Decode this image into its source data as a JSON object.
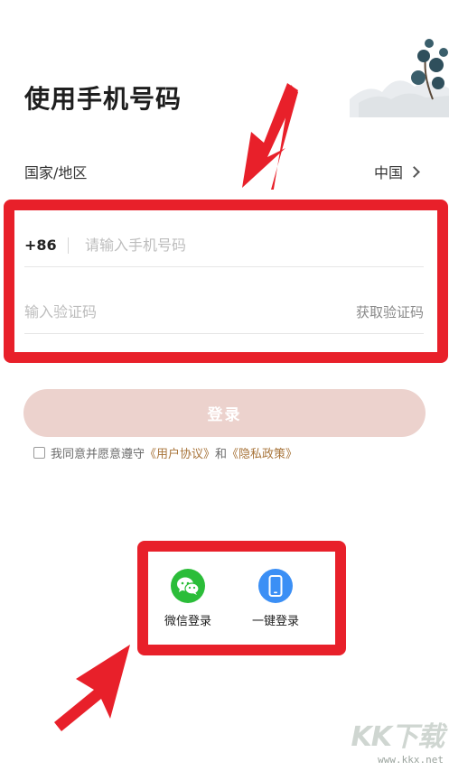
{
  "header": {
    "title": "使用手机号码"
  },
  "region": {
    "label": "国家/地区",
    "value": "中国"
  },
  "form": {
    "country_code": "+86",
    "phone_placeholder": "请输入手机号码",
    "code_placeholder": "输入验证码",
    "get_code_label": "获取验证码",
    "login_label": "登录"
  },
  "agreement": {
    "prefix": "我同意并愿意遵守",
    "user_agreement": "《用户协议》",
    "and": "和",
    "privacy_policy": "《隐私政策》",
    "checked": false
  },
  "social": [
    {
      "label": "微信登录",
      "icon": "wechat-icon"
    },
    {
      "label": "一键登录",
      "icon": "phone-icon"
    }
  ],
  "watermark": {
    "logo": "KK下载",
    "url": "www.kkx.net"
  },
  "colors": {
    "highlight": "#e8202a",
    "login_button": "#ecd2cd",
    "link": "#a8743a",
    "wechat": "#2bbd39",
    "onekey": "#3b8ff5"
  }
}
